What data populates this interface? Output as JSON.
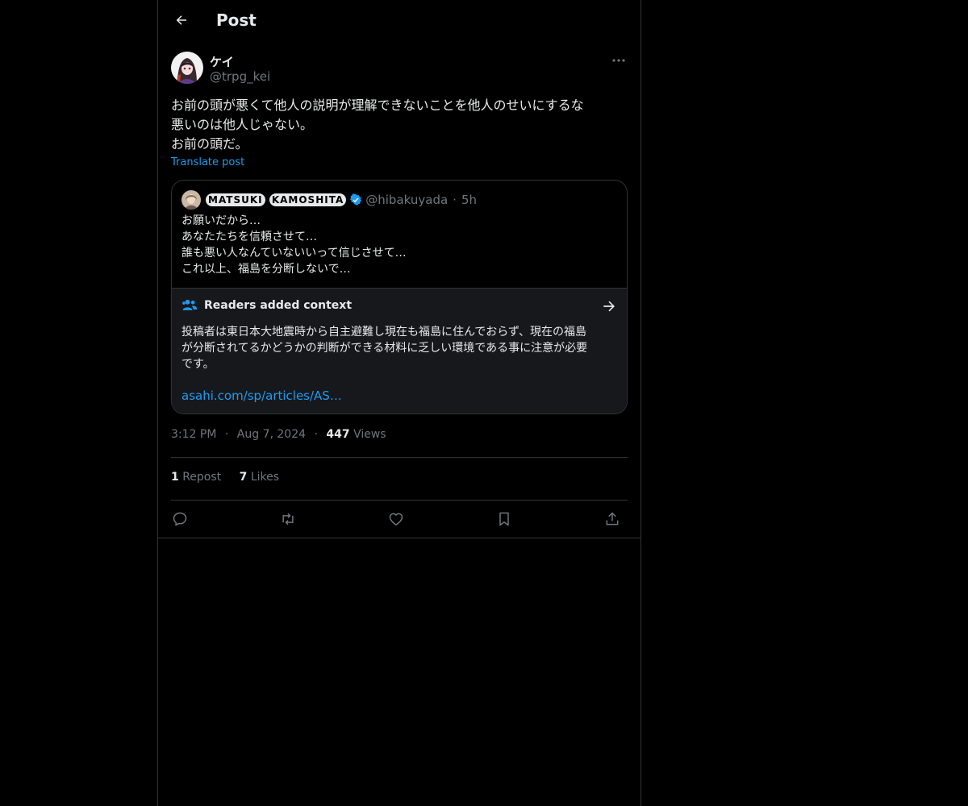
{
  "header": {
    "title": "Post"
  },
  "post": {
    "author_name": "ケイ",
    "author_handle": "@trpg_kei",
    "text_lines": [
      "お前の頭が悪くて他人の説明が理解できないことを他人のせいにするな",
      "悪いのは他人じゃない。",
      "お前の頭だ。"
    ],
    "translate_label": "Translate post",
    "time": "3:12 PM",
    "date": "Aug 7, 2024",
    "views_count": "447",
    "views_label": "Views",
    "reposts_count": "1",
    "reposts_label": "Repost",
    "likes_count": "7",
    "likes_label": "Likes"
  },
  "quote": {
    "name_parts": [
      "MATSUKI",
      "KAMOSHITA"
    ],
    "handle": "@hibakuyada",
    "separator": "·",
    "age": "5h",
    "text_lines": [
      "お願いだから…",
      "あなたたちを信頼させて…",
      "誰も悪い人なんていないいって信じさせて…",
      "これ以上、福島を分断しないで…"
    ]
  },
  "context": {
    "title": "Readers added context",
    "body_lines": [
      "投稿者は東日本大地震時から自主避難し現在も福島に住んでおらず、現在の福島",
      "が分断されてるかどうかの判断ができる材料に乏しい環境である事に注意が必要",
      "です。"
    ],
    "link": "asahi.com/sp/articles/AS…"
  },
  "meta_separator": "·",
  "icons": {
    "back": "arrow-left-icon",
    "more": "more-horizontal-icon",
    "verified": "verified-badge-icon",
    "readers": "people-icon",
    "context_arrow": "arrow-right-icon",
    "reply": "reply-icon",
    "repost": "repost-icon",
    "like": "heart-icon",
    "bookmark": "bookmark-icon",
    "share": "share-icon"
  },
  "colors": {
    "background": "#000000",
    "text": "#e7e9ea",
    "secondary_text": "#71767b",
    "accent": "#1d9bf0",
    "border": "#2f3336"
  }
}
